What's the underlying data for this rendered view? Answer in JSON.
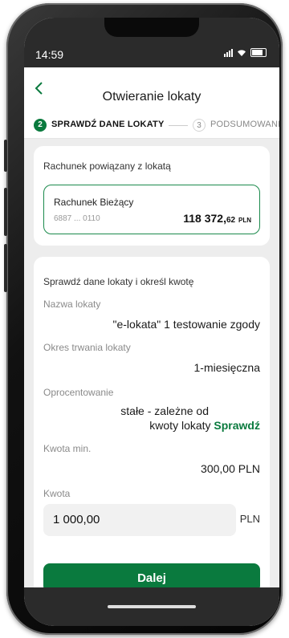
{
  "status": {
    "time": "14:59"
  },
  "header": {
    "title": "Otwieranie lokaty"
  },
  "steps": [
    {
      "num": "2",
      "label": "SPRAWDŹ DANE LOKATY"
    },
    {
      "num": "3",
      "label": "PODSUMOWANI"
    }
  ],
  "account_card": {
    "heading": "Rachunek powiązany z lokatą",
    "account_name": "Rachunek Bieżący",
    "account_number": "6887 ... 0110",
    "balance_main": "118 372,",
    "balance_cents": "62",
    "currency": "PLN"
  },
  "details": {
    "heading": "Sprawdź dane lokaty i określ kwotę",
    "name_label": "Nazwa lokaty",
    "name_value": "\"e-lokata\"  1 testowanie zgody",
    "period_label": "Okres trwania lokaty",
    "period_value": "1-miesięczna",
    "rate_label": "Oprocentowanie",
    "rate_line1": "stałe - zależne od",
    "rate_line2": "kwoty lokaty",
    "rate_link": "Sprawdź",
    "min_label": "Kwota min.",
    "min_value": "300,00 PLN",
    "amount_label": "Kwota",
    "amount_value": "1 000,00",
    "amount_currency": "PLN",
    "submit_label": "Dalej"
  },
  "colors": {
    "accent": "#0a7a3e",
    "background": "#ededed"
  }
}
